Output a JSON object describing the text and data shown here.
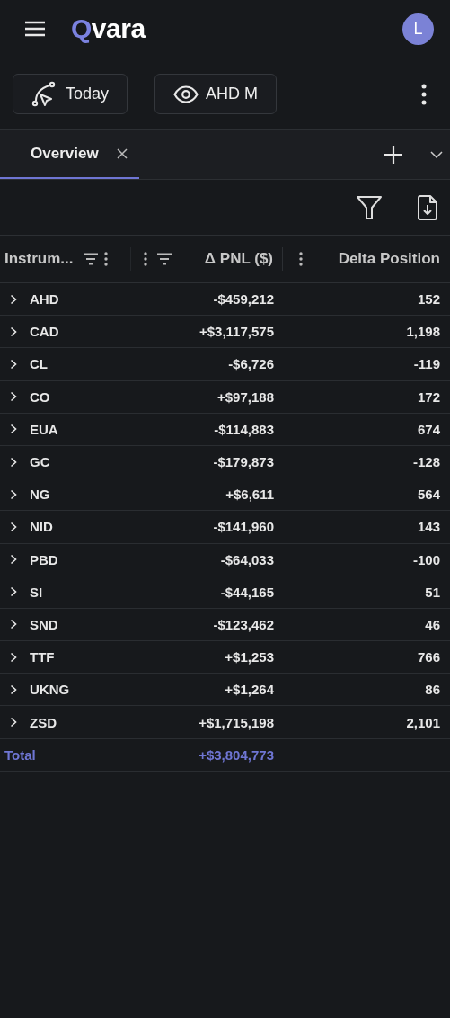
{
  "header": {
    "logo": "Qvara",
    "avatar": "L"
  },
  "toolbar": {
    "buttons": [
      {
        "kind": "date",
        "label": "Today"
      },
      {
        "kind": "view",
        "label": "AHD M"
      }
    ]
  },
  "tabs": [
    {
      "label": "Overview",
      "selected": true
    }
  ],
  "table": {
    "columns": [
      {
        "label": "Instrum..."
      },
      {
        "label": "Δ PNL ($)"
      },
      {
        "label": "Delta Position"
      }
    ],
    "rows": [
      {
        "instrument": "AHD",
        "pnl": "-$459,212",
        "delta": "152",
        "expanded": false
      },
      {
        "instrument": "CAD",
        "pnl": "+$3,117,575",
        "delta": "1,198",
        "expanded": false
      },
      {
        "instrument": "CL",
        "pnl": "-$6,726",
        "delta": "-119",
        "expanded": false
      },
      {
        "instrument": "CO",
        "pnl": "+$97,188",
        "delta": "172",
        "expanded": false
      },
      {
        "instrument": "EUA",
        "pnl": "-$114,883",
        "delta": "674",
        "expanded": false
      },
      {
        "instrument": "GC",
        "pnl": "-$179,873",
        "delta": "-128",
        "expanded": false
      },
      {
        "instrument": "NG",
        "pnl": "+$6,611",
        "delta": "564",
        "expanded": false
      },
      {
        "instrument": "NID",
        "pnl": "-$141,960",
        "delta": "143",
        "expanded": false
      },
      {
        "instrument": "PBD",
        "pnl": "-$64,033",
        "delta": "-100",
        "expanded": false
      },
      {
        "instrument": "SI",
        "pnl": "-$44,165",
        "delta": "51",
        "expanded": false
      },
      {
        "instrument": "SND",
        "pnl": "-$123,462",
        "delta": "46",
        "expanded": false
      },
      {
        "instrument": "TTF",
        "pnl": "+$1,253",
        "delta": "766",
        "expanded": false
      },
      {
        "instrument": "UKNG",
        "pnl": "+$1,264",
        "delta": "86",
        "expanded": false
      },
      {
        "instrument": "ZSD",
        "pnl": "+$1,715,198",
        "delta": "2,101",
        "expanded": false
      }
    ],
    "total": {
      "label": "Total",
      "pnl": "+$3,804,773"
    }
  }
}
